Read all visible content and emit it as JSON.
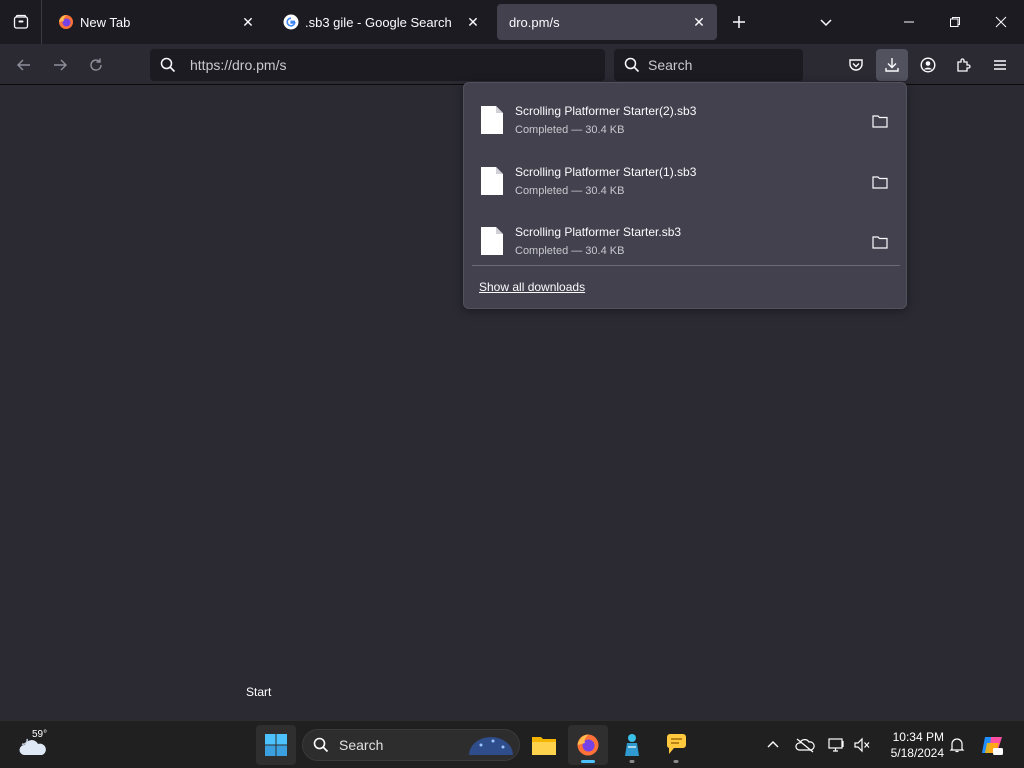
{
  "tabs": [
    {
      "title": "New Tab",
      "icon": "firefox-icon",
      "active": false
    },
    {
      "title": ".sb3 gile - Google Search",
      "icon": "google-icon",
      "active": false
    },
    {
      "title": "dro.pm/s",
      "icon": "",
      "active": true
    }
  ],
  "nav": {
    "url": "https://dro.pm/s",
    "search_placeholder": "Search"
  },
  "downloads": {
    "items": [
      {
        "name": "Scrolling Platformer Starter(2).sb3",
        "status": "Completed — 30.4 KB"
      },
      {
        "name": "Scrolling Platformer Starter(1).sb3",
        "status": "Completed — 30.4 KB"
      },
      {
        "name": "Scrolling Platformer Starter.sb3",
        "status": "Completed — 30.4 KB"
      }
    ],
    "show_all": "Show all downloads"
  },
  "tooltip": "Start",
  "taskbar": {
    "weather_temp": "59°",
    "search_placeholder": "Search",
    "time": "10:34 PM",
    "date": "5/18/2024"
  },
  "colors": {
    "accent": "#4cc2ff",
    "panel": "#42414d",
    "toolbar": "#2b2a33"
  }
}
